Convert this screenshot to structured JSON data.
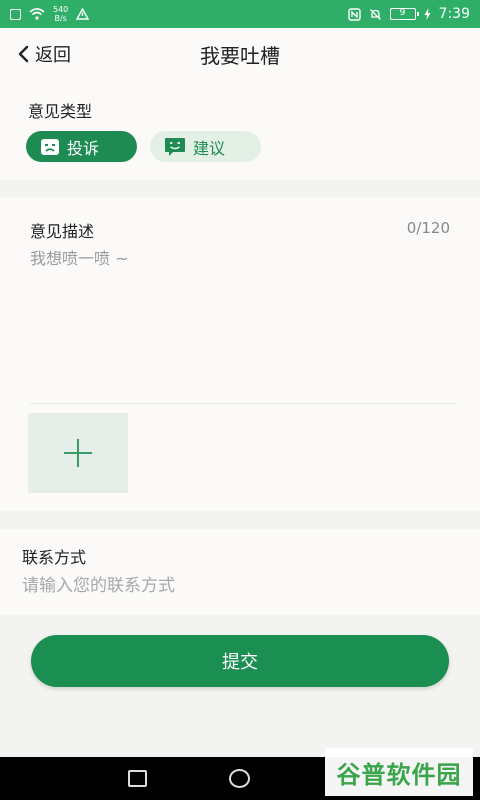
{
  "status_bar": {
    "speed_value": "540",
    "speed_unit": "B/s",
    "battery": "9",
    "time": "7:39"
  },
  "nav": {
    "back_label": "返回",
    "title": "我要吐槽"
  },
  "opinion_type": {
    "label": "意见类型",
    "options": [
      {
        "label": "投诉",
        "selected": true
      },
      {
        "label": "建议",
        "selected": false
      }
    ]
  },
  "description": {
    "label": "意见描述",
    "counter": "0/120",
    "value": "",
    "placeholder": "我想喷一喷 ~"
  },
  "contact": {
    "label": "联系方式",
    "value": "",
    "placeholder": "请输入您的联系方式"
  },
  "submit_label": "提交",
  "watermark": "谷普软件园",
  "colors": {
    "status_bar": "#2fae68",
    "accent": "#1b8e52",
    "chip_inactive_bg": "#e3f0e6",
    "upload_bg": "#e5eee8",
    "page_bg": "#f3f3f1",
    "card_bg": "#fbfaf8"
  }
}
